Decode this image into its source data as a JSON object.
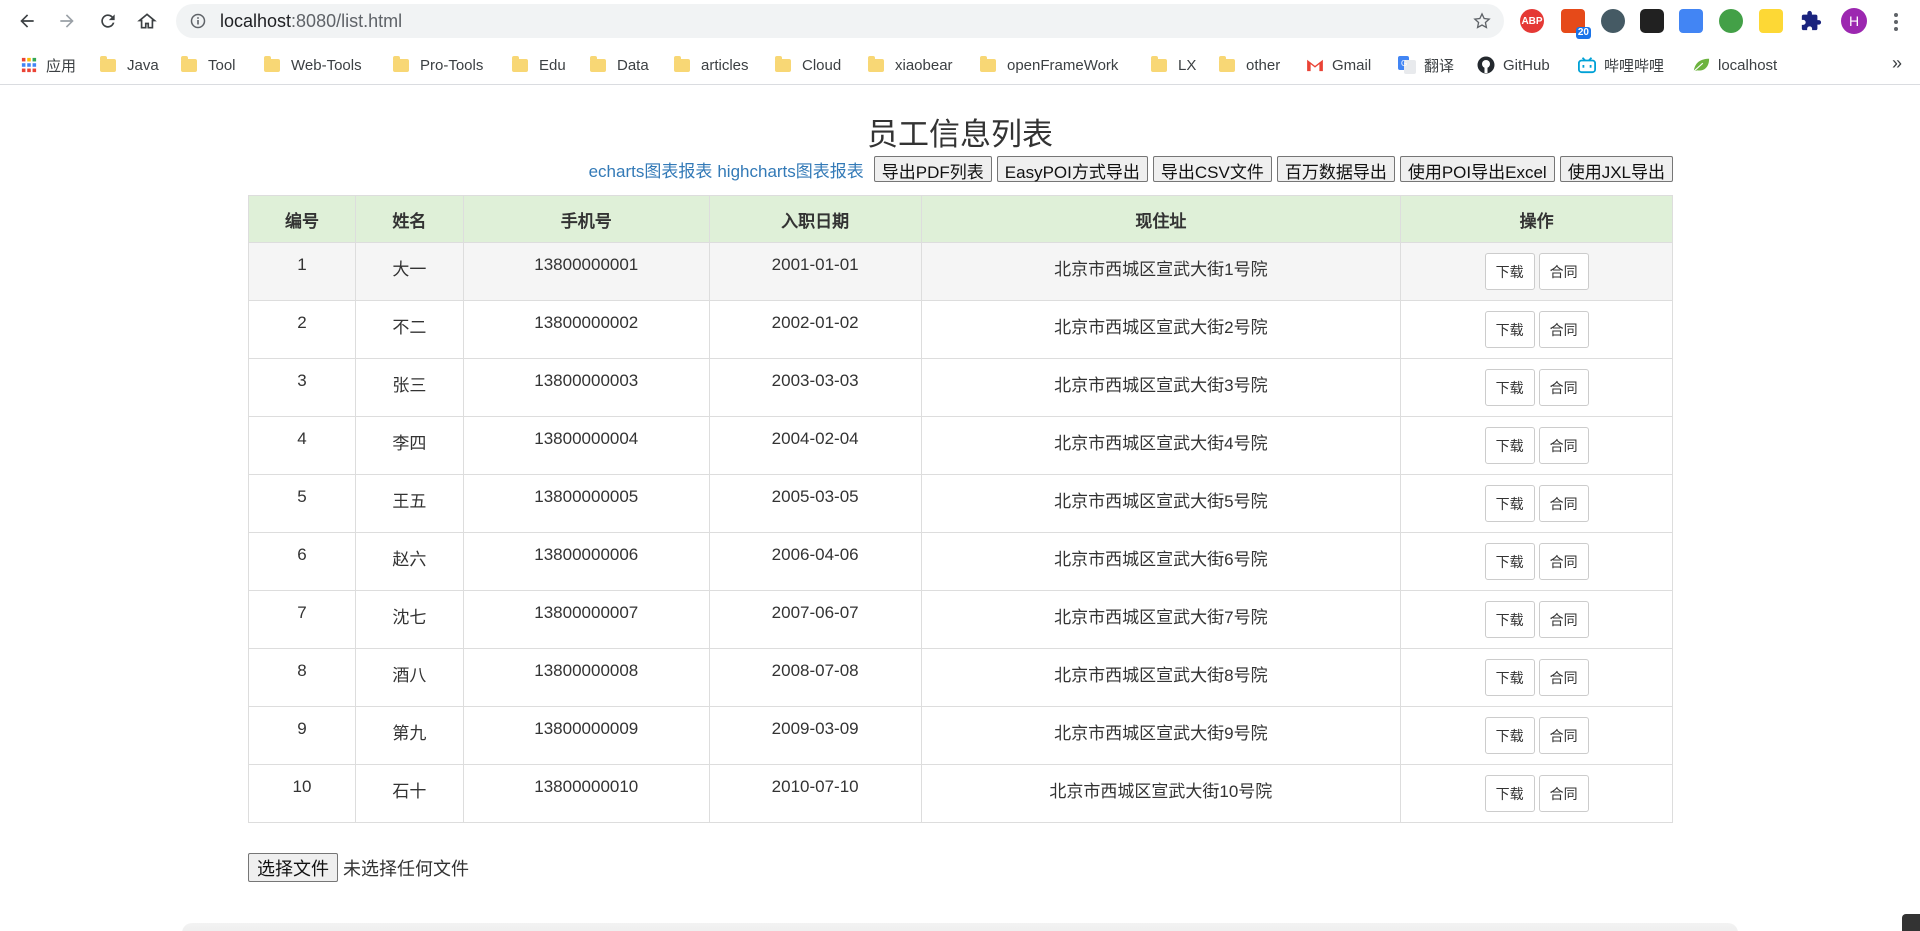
{
  "browser": {
    "url_host": "localhost",
    "url_rest": ":8080/list.html",
    "ext_badge": "20",
    "ext_abp": "ABP",
    "avatar_letter": "H",
    "bookmarks": [
      {
        "label": "应用",
        "icon": "apps-grid-icon"
      },
      {
        "label": "Java",
        "icon": "folder-icon"
      },
      {
        "label": "Tool",
        "icon": "folder-icon"
      },
      {
        "label": "Web-Tools",
        "icon": "folder-icon"
      },
      {
        "label": "Pro-Tools",
        "icon": "folder-icon"
      },
      {
        "label": "Edu",
        "icon": "folder-icon"
      },
      {
        "label": "Data",
        "icon": "folder-icon"
      },
      {
        "label": "articles",
        "icon": "folder-icon"
      },
      {
        "label": "Cloud",
        "icon": "folder-icon"
      },
      {
        "label": "xiaobear",
        "icon": "folder-icon"
      },
      {
        "label": "openFrameWork",
        "icon": "folder-icon"
      },
      {
        "label": "LX",
        "icon": "folder-icon"
      },
      {
        "label": "other",
        "icon": "folder-icon"
      },
      {
        "label": "Gmail",
        "icon": "gmail-icon"
      },
      {
        "label": "翻译",
        "icon": "translate-icon"
      },
      {
        "label": "GitHub",
        "icon": "github-icon"
      },
      {
        "label": "哔哩哔哩",
        "icon": "bilibili-icon"
      },
      {
        "label": "localhost",
        "icon": "leaf-icon"
      }
    ],
    "more_label": "»"
  },
  "page": {
    "title": "员工信息列表",
    "links": [
      "echarts图表报表",
      "highcharts图表报表"
    ],
    "buttons": [
      "导出PDF列表",
      "EasyPOI方式导出",
      "导出CSV文件",
      "百万数据导出",
      "使用POI导出Excel",
      "使用JXL导出"
    ],
    "table": {
      "headers": [
        "编号",
        "姓名",
        "手机号",
        "入职日期",
        "现住址",
        "操作"
      ],
      "rows": [
        [
          "1",
          "大一",
          "13800000001",
          "2001-01-01",
          "北京市西城区宣武大街1号院"
        ],
        [
          "2",
          "不二",
          "13800000002",
          "2002-01-02",
          "北京市西城区宣武大街2号院"
        ],
        [
          "3",
          "张三",
          "13800000003",
          "2003-03-03",
          "北京市西城区宣武大街3号院"
        ],
        [
          "4",
          "李四",
          "13800000004",
          "2004-02-04",
          "北京市西城区宣武大街4号院"
        ],
        [
          "5",
          "王五",
          "13800000005",
          "2005-03-05",
          "北京市西城区宣武大街5号院"
        ],
        [
          "6",
          "赵六",
          "13800000006",
          "2006-04-06",
          "北京市西城区宣武大街6号院"
        ],
        [
          "7",
          "沈七",
          "13800000007",
          "2007-06-07",
          "北京市西城区宣武大街7号院"
        ],
        [
          "8",
          "酒八",
          "13800000008",
          "2008-07-08",
          "北京市西城区宣武大街8号院"
        ],
        [
          "9",
          "第九",
          "13800000009",
          "2009-03-09",
          "北京市西城区宣武大街9号院"
        ],
        [
          "10",
          "石十",
          "13800000010",
          "2010-07-10",
          "北京市西城区宣武大街10号院"
        ]
      ],
      "op_download": "下载",
      "op_contract": "合同"
    },
    "file_button": "选择文件",
    "file_status": "未选择任何文件"
  }
}
